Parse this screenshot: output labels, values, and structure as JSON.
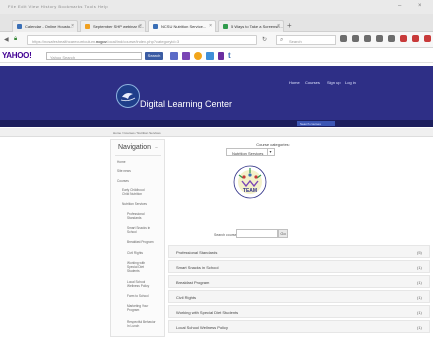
{
  "browser": {
    "menu_text": "File  Edit  View  History  Bookmarks  Tools  Help",
    "window_controls": [
      "–",
      "×"
    ],
    "tabs": [
      {
        "label": "Calendar - Online Housto...",
        "active": false,
        "favicon_color": "#3a6fb6"
      },
      {
        "label": "September SHP webinar S...",
        "active": false,
        "favicon_color": "#f0a020"
      },
      {
        "label": "NCSU Nutrition Service...",
        "active": true,
        "favicon_color": "#3a6fb6"
      },
      {
        "label": "5 Ways to Take a Screensh...",
        "active": false,
        "favicon_color": "#2e9a4b"
      }
    ],
    "new_tab": "+",
    "url_prefix": "https://",
    "url_host": "ncsafeshealthcarecurriculum.",
    "url_domain": "ncgov",
    "url_rest": ".local/ind/course/index.php?categoryid=3",
    "reload_icon": "↻",
    "search_placeholder": "Search"
  },
  "yahoo": {
    "logo": "YAHOO!",
    "search_placeholder": "Yahoo Search",
    "search_button": "Search",
    "twitter_glyph": "t",
    "icon_colors": [
      "#5b6bc7",
      "#7a46b5",
      "#f2a51a",
      "#3f8fd8",
      "#6a2da0"
    ]
  },
  "site": {
    "title": "Digital Learning Center",
    "nav": [
      "Home",
      "Courses",
      "Sign up",
      "Log in"
    ],
    "course_search": "Search courses",
    "breadcrumb": "Home / Courses / Nutrition Services"
  },
  "navigation": {
    "title": "Navigation",
    "collapse": "−",
    "items": [
      "Home",
      "Site news",
      "Courses",
      "Early Childhood\nChild Nutrition",
      "Nutrition Services",
      "Professional\nStandards",
      "Smart Snacks in\nSchool",
      "Breakfast Program",
      "Civil Rights",
      "Working with\nSpecial Diet\nStudents",
      "Local School\nWellness Policy",
      "Farm to School",
      "Marketing Your\nProgram",
      "Respectful Behavior\nIn Lunch"
    ]
  },
  "main": {
    "category_label": "Course categories:",
    "category_value": "Nutrition Services",
    "search_label": "Search courses:",
    "search_go": "Go",
    "team_text": "TEAM",
    "categories": [
      {
        "name": "Professional Standards",
        "count": "(5)"
      },
      {
        "name": "Smart Snacks in School",
        "count": "(1)"
      },
      {
        "name": "Breakfast Program",
        "count": "(1)"
      },
      {
        "name": "Civil Rights",
        "count": "(1)"
      },
      {
        "name": "Working with Special Diet Students",
        "count": "(1)"
      },
      {
        "name": "Local School Wellness Policy",
        "count": "(1)"
      }
    ]
  }
}
